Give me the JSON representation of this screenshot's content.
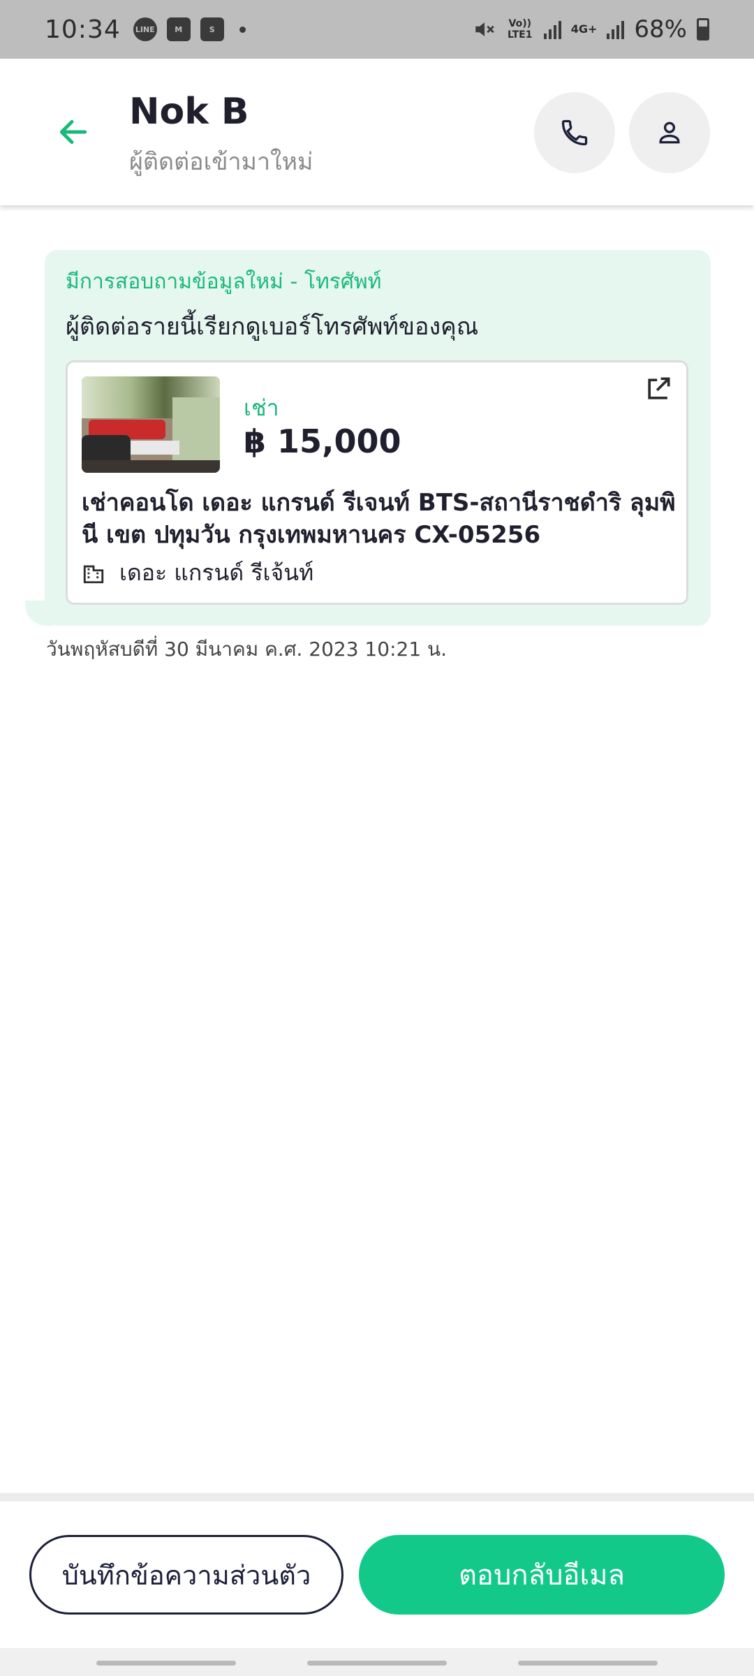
{
  "status_bar": {
    "time": "10:34",
    "notification_icons": [
      "line-icon",
      "gmail-icon",
      "shopee-icon"
    ],
    "volte_label": "Vo)) LTE1",
    "network_label": "4G+",
    "battery": "68%"
  },
  "header": {
    "contact_name": "Nok B",
    "subtitle": "ผู้ติดต่อเข้ามาใหม่"
  },
  "message": {
    "title": "มีการสอบถามข้อมูลใหม่ - โทรศัพท์",
    "body": "ผู้ติดต่อรายนี้เรียกดูเบอร์โทรศัพท์ของคุณ",
    "timestamp": "วันพฤหัสบดีที่ 30 มีนาคม ค.ศ. 2023 10:21 น."
  },
  "listing": {
    "type_label": "เช่า",
    "price": "฿ 15,000",
    "title": "เช่าคอนโด เดอะ แกรนด์ รีเจนท์ BTS-สถานีราชดำริ ลุมพินี เขต ปทุมวัน กรุงเทพมหานคร CX-05256",
    "building": "เดอะ แกรนด์ รีเจ้นท์"
  },
  "actions": {
    "note_label": "บันทึกข้อความส่วนตัว",
    "reply_label": "ตอบกลับอีเมล"
  },
  "colors": {
    "accent": "#12c98a",
    "bubble_bg": "#e6f7f0",
    "navy": "#1c1f3a"
  }
}
